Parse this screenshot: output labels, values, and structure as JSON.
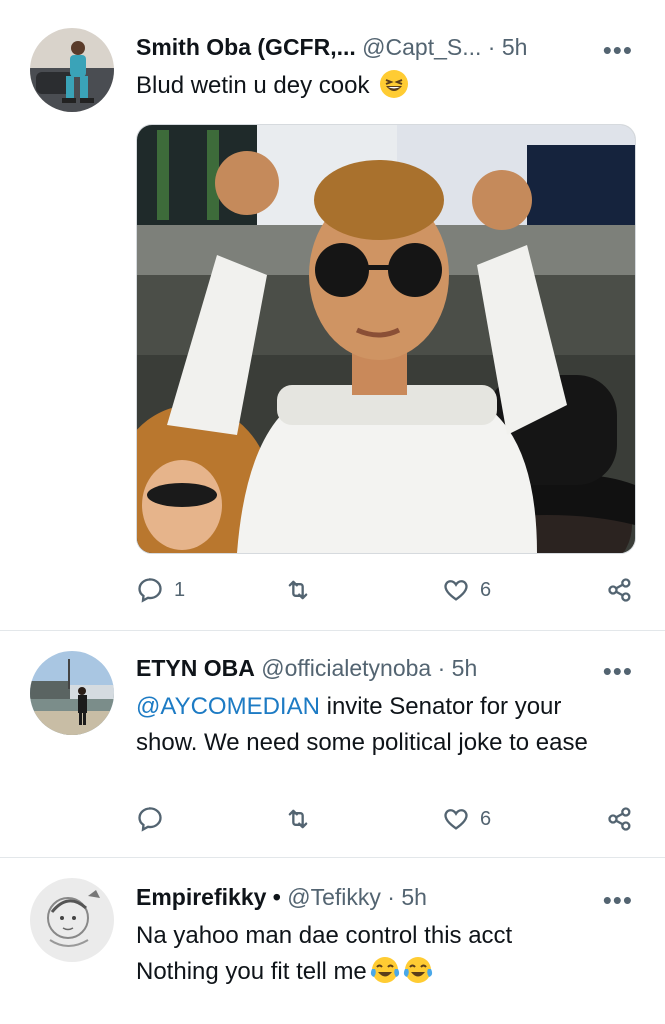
{
  "tweets": [
    {
      "name": "Smith Oba (GCFR,...",
      "handle": "@Capt_S...",
      "time": "5h",
      "more": "•••",
      "text": "Blud wetin u dey cook",
      "emoji": "grinning-squinting-face",
      "reply_count": "1",
      "retweet_count": "",
      "like_count": "6"
    },
    {
      "name": "ETYN OBA",
      "handle": "@officialetynoba",
      "time": "5h",
      "more": "•••",
      "mention": "@AYCOMEDIAN",
      "text_after_mention": " invite Senator for your",
      "text_line2": "show. We need some political joke to ease",
      "reply_count": "",
      "retweet_count": "",
      "like_count": "6"
    },
    {
      "name": "Empirefikky",
      "name_suffix": "•",
      "handle": "@Tefikky",
      "time": "5h",
      "more": "•••",
      "text_line1": "Na yahoo man dae control this acct",
      "text_line2": "Nothing you fit tell me",
      "emoji": "face-with-tears-of-joy"
    }
  ],
  "separator": "·",
  "colors": {
    "text": "#0f1419",
    "muted": "#536471",
    "link": "#1d7bc4",
    "divider": "#e3e7ea"
  }
}
